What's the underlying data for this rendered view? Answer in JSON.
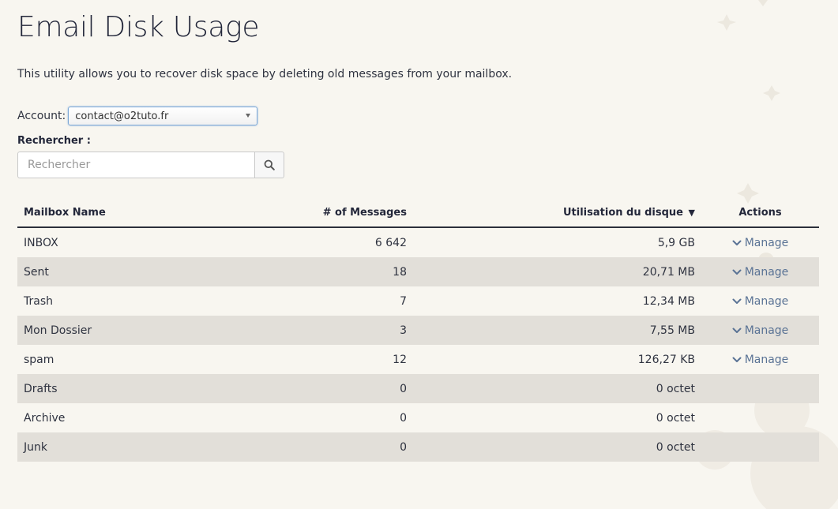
{
  "page": {
    "title": "Email Disk Usage",
    "description": "This utility allows you to recover disk space by deleting old messages from your mailbox."
  },
  "account": {
    "label": "Account:",
    "selected": "contact@o2tuto.fr"
  },
  "search": {
    "label": "Rechercher :",
    "placeholder": "Rechercher",
    "icon": "search-icon"
  },
  "table": {
    "headers": {
      "name": "Mailbox Name",
      "messages": "# of Messages",
      "usage": "Utilisation du disque",
      "usage_sort": "▼",
      "actions": "Actions"
    },
    "rows": [
      {
        "name": "INBOX",
        "messages": "6 642",
        "usage": "5,9 GB",
        "action": "Manage"
      },
      {
        "name": "Sent",
        "messages": "18",
        "usage": "20,71 MB",
        "action": "Manage"
      },
      {
        "name": "Trash",
        "messages": "7",
        "usage": "12,34 MB",
        "action": "Manage"
      },
      {
        "name": "Mon Dossier",
        "messages": "3",
        "usage": "7,55 MB",
        "action": "Manage"
      },
      {
        "name": "spam",
        "messages": "12",
        "usage": "126,27 KB",
        "action": "Manage"
      },
      {
        "name": "Drafts",
        "messages": "0",
        "usage": "0 octet",
        "action": ""
      },
      {
        "name": "Archive",
        "messages": "0",
        "usage": "0 octet",
        "action": ""
      },
      {
        "name": "Junk",
        "messages": "0",
        "usage": "0 octet",
        "action": ""
      }
    ]
  },
  "colors": {
    "background": "#f8f6f0",
    "row_alt": "#e2dfd9",
    "link": "#5a7395",
    "text": "#2b2f3a"
  }
}
